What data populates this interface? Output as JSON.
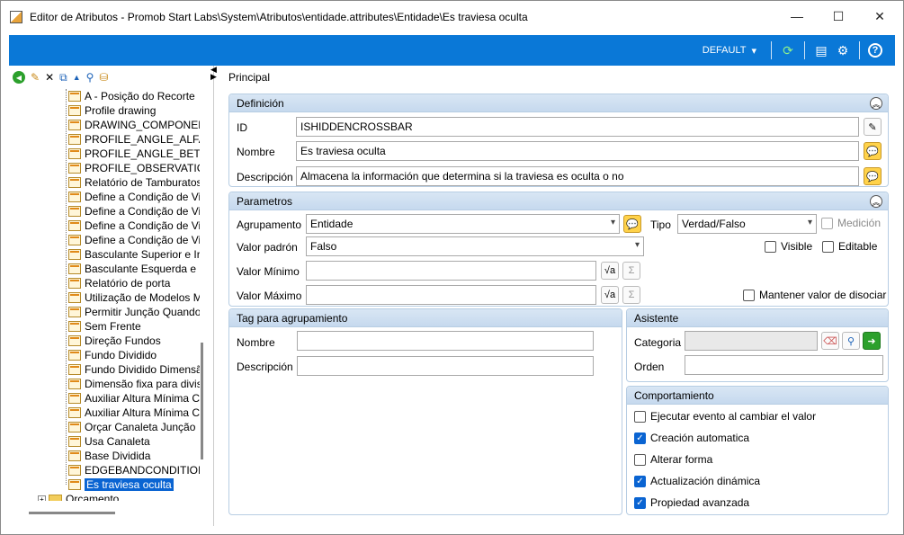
{
  "window": {
    "title": "Editor de Atributos - Promob Start Labs\\System\\Atributos\\entidade.attributes\\Entidade\\Es traviesa oculta",
    "minimize": "—",
    "maximize": "☐",
    "close": "✕"
  },
  "toolbar": {
    "default_label": "DEFAULT",
    "default_arrow": "▾",
    "refresh_icon": "⟳",
    "layout_icon": "▤",
    "settings_icon": "⚙",
    "help_icon": "?"
  },
  "tree_toolbar": {
    "back": "◀",
    "new": "✎",
    "delete": "✕",
    "copy": "⧉",
    "up": "▲",
    "search": "⚲",
    "find": "⛁"
  },
  "tree": {
    "items": [
      "A - Posição do Recorte",
      "Profile drawing",
      "DRAWING_COMPONEN",
      "PROFILE_ANGLE_ALFA",
      "PROFILE_ANGLE_BETA",
      "PROFILE_OBSERVATIC",
      "Relatório de Tamburatos",
      "Define a Condição de Vi",
      "Define a Condição de Vi",
      "Define a Condição de Vi",
      "Define a Condição de Vi",
      "Basculante Superior e Ir",
      "Basculante Esquerda e I",
      "Relatório de porta",
      "Utilização de Modelos M",
      "Permitir Junção Quando",
      "Sem Frente",
      "Direção Fundos",
      "Fundo Dividido",
      "Fundo Dividido Dimensã",
      "Dimensão fixa para divis",
      "Auxiliar Altura Mínima C",
      "Auxiliar Altura Mínima C",
      "Orçar Canaleta Junção",
      "Usa Canaleta",
      "Base Dividida",
      "EDGEBANDCONDITIOI",
      "Es traviesa oculta"
    ],
    "root_label": "Orçamento"
  },
  "main": {
    "tab": "Principal",
    "definicion": {
      "title": "Definición",
      "id_label": "ID",
      "id_value": "ISHIDDENCROSSBAR",
      "nombre_label": "Nombre",
      "nombre_value": "Es traviesa oculta",
      "descripcion_label": "Descripción",
      "descripcion_value": "Almacena la información que determina si la traviesa es oculta o no"
    },
    "parametros": {
      "title": "Parametros",
      "agrupamento_label": "Agrupamento",
      "agrupamento_value": "Entidade",
      "tipo_label": "Tipo",
      "tipo_value": "Verdad/Falso",
      "medicion_label": "Medición",
      "valor_padron_label": "Valor padrón",
      "valor_padron_value": "Falso",
      "visible_label": "Visible",
      "editable_label": "Editable",
      "valor_minimo_label": "Valor Mínimo",
      "valor_maximo_label": "Valor Máximo",
      "mantener_label": "Mantener valor de disociar",
      "formula_icon": "√a",
      "sigma_icon": "Σ"
    },
    "tag": {
      "title": "Tag para agrupamiento",
      "nombre_label": "Nombre",
      "descripcion_label": "Descripción"
    },
    "asistente": {
      "title": "Asistente",
      "categoria_label": "Categoria",
      "orden_label": "Orden"
    },
    "comportamiento": {
      "title": "Comportamiento",
      "items": [
        {
          "label": "Ejecutar evento al cambiar el valor",
          "checked": false
        },
        {
          "label": "Creación automatica",
          "checked": true
        },
        {
          "label": "Alterar forma",
          "checked": false
        },
        {
          "label": "Actualización dinámica",
          "checked": true
        },
        {
          "label": "Propiedad avanzada",
          "checked": true
        }
      ]
    }
  },
  "colors": {
    "toolbar_blue": "#0a78d7",
    "group_header": "#c6d9ee",
    "selection": "#0a64d2",
    "checkbox_checked": "#0a64d2"
  }
}
